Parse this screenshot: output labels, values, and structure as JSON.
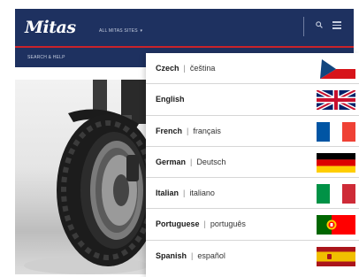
{
  "header": {
    "logo": "Mitas",
    "sites_label": "ALL MITAS SITES",
    "sites_caret": "▾",
    "nav_link": "SEARCH & HELP"
  },
  "icons": {
    "search": "search-icon",
    "menu": "hamburger-menu-icon"
  },
  "colors": {
    "header_bg": "#1e3160",
    "accent_red": "#c9232b"
  },
  "languages": [
    {
      "english": "Czech",
      "native": "čeština",
      "flag": "czech-flag-icon"
    },
    {
      "english": "English",
      "native": "",
      "flag": "uk-flag-icon"
    },
    {
      "english": "French",
      "native": "français",
      "flag": "french-flag-icon"
    },
    {
      "english": "German",
      "native": "Deutsch",
      "flag": "german-flag-icon"
    },
    {
      "english": "Italian",
      "native": "italiano",
      "flag": "italian-flag-icon"
    },
    {
      "english": "Portuguese",
      "native": "português",
      "flag": "portuguese-flag-icon"
    },
    {
      "english": "Spanish",
      "native": "español",
      "flag": "spanish-flag-icon"
    }
  ],
  "separator": "|"
}
